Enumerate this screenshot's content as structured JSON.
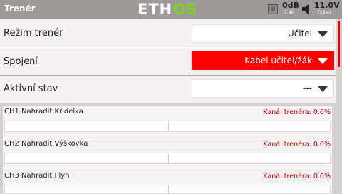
{
  "header": {
    "title": "Trenér",
    "logo_left": "ETH",
    "logo_right": "OS",
    "rssi_value": "0dB",
    "rssi_sub": "2.4G",
    "battery_value": "11.0V",
    "battery_sub": "TxBatt"
  },
  "settings": [
    {
      "label": "Režim trenér",
      "value": "Učitel",
      "highlighted": false
    },
    {
      "label": "Spojení",
      "value": "Kabel učitel/žák",
      "highlighted": true
    },
    {
      "label": "Aktivní stav",
      "value": "---",
      "highlighted": false
    }
  ],
  "channels": [
    {
      "name": "CH1 Nahradit Křidélka",
      "value": "Kanál trenéra: 0.0%",
      "position": 0.0
    },
    {
      "name": "CH2 Nahradit Výškovka",
      "value": "Kanál trenéra: 0.0%",
      "position": 0.0
    },
    {
      "name": "CH3 Nahradit Plyn",
      "value": "Kanál trenéra: 0.0%",
      "position": 0.0
    }
  ],
  "colors": {
    "accent": "#ff0000",
    "header_bg": "#9e9a9a",
    "logo_green": "#7ed321"
  }
}
